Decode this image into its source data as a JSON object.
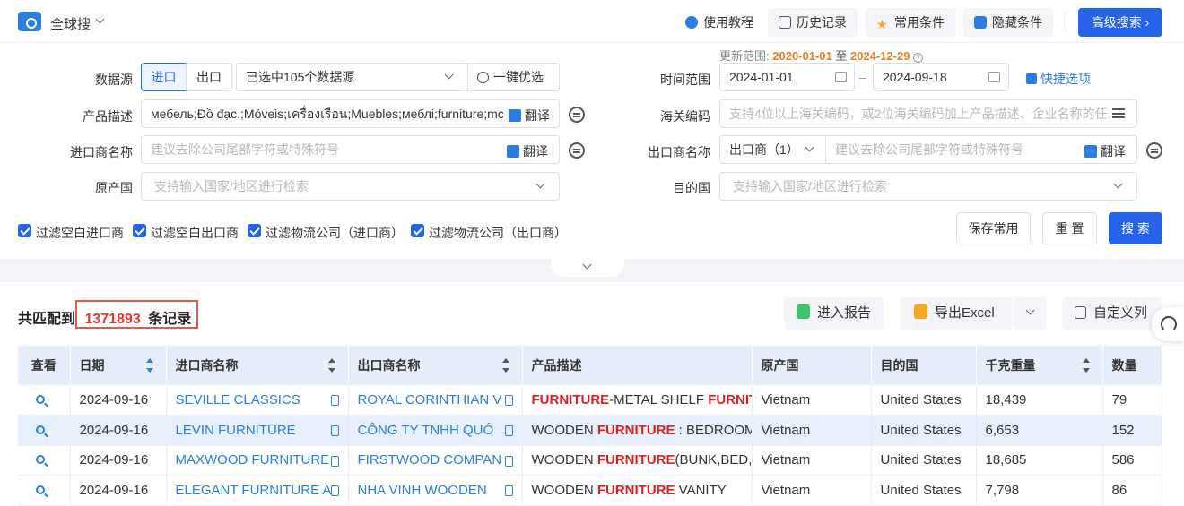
{
  "header": {
    "app_title": "全球搜",
    "buttons": [
      "使用教程",
      "历史记录",
      "常用条件",
      "隐藏条件"
    ],
    "advanced_search": "高级搜索",
    "advanced_arrow": "›"
  },
  "update_range": {
    "label": "更新范围:",
    "start": "2020-01-01",
    "sep": "至",
    "end": "2024-12-29"
  },
  "form": {
    "data_source": {
      "label": "数据源",
      "import": "进口",
      "export": "出口",
      "selected": "已选中105个数据源",
      "optimize": "一键优选"
    },
    "time_range": {
      "label": "时间范围",
      "start": "2024-01-01",
      "end": "2024-09-18",
      "dash": "–",
      "quick": "快捷选项"
    },
    "product_desc": {
      "label": "产品描述",
      "value": "мебель;Đồ đạc.;Móveis;เครื่องเรือน;Muebles;меблі;furniture;mc",
      "translate": "翻译"
    },
    "hs_code": {
      "label": "海关编码",
      "placeholder": "支持4位以上海关编码，或2位海关编码加上产品描述、企业名称的任..."
    },
    "importer": {
      "label": "进口商名称",
      "placeholder": "建议去除公司尾部字符或特殊符号",
      "translate": "翻译"
    },
    "exporter": {
      "label": "出口商名称",
      "type": "出口商（1）",
      "placeholder": "建议去除公司尾部字符或特殊符号",
      "translate": "翻译"
    },
    "origin": {
      "label": "原产国",
      "placeholder": "支持输入国家/地区进行检索"
    },
    "destination": {
      "label": "目的国",
      "placeholder": "支持输入国家/地区进行检索"
    },
    "filters": [
      "过滤空白进口商",
      "过滤空白出口商",
      "过滤物流公司（进口商）",
      "过滤物流公司（出口商）"
    ],
    "save": "保存常用",
    "reset": "重 置",
    "search": "搜 索"
  },
  "results": {
    "prefix": "共匹配到",
    "count": "1371893",
    "suffix": "条记录",
    "report": "进入报告",
    "export": "导出Excel",
    "custom": "自定义列"
  },
  "table": {
    "columns": [
      "查看",
      "日期",
      "进口商名称",
      "出口商名称",
      "产品描述",
      "原产国",
      "目的国",
      "千克重量",
      "数量"
    ],
    "rows": [
      {
        "date": "2024-09-16",
        "importer": "SEVILLE CLASSICS",
        "exporter": "ROYAL CORINTHIAN V",
        "desc_pre": "",
        "desc_hl": "FURNITURE",
        "desc_post": "-METAL SHELF ",
        "desc_hl2": "FURNIT",
        "origin": "Vietnam",
        "dest": "United States",
        "kg": "18,439",
        "qty": "79"
      },
      {
        "date": "2024-09-16",
        "importer": "LEVIN FURNITURE",
        "exporter": "CÔNG TY TNHH QUÓ",
        "desc_pre": "WOODEN ",
        "desc_hl": "FURNITURE",
        "desc_post": " : BEDROOM",
        "desc_hl2": "",
        "origin": "Vietnam",
        "dest": "United States",
        "kg": "6,653",
        "qty": "152"
      },
      {
        "date": "2024-09-16",
        "importer": "MAXWOOD FURNITURE",
        "exporter": "FIRSTWOOD COMPAN",
        "desc_pre": "WOODEN ",
        "desc_hl": "FURNITURE",
        "desc_post": "(BUNK,BED,C",
        "desc_hl2": "",
        "origin": "Vietnam",
        "dest": "United States",
        "kg": "18,685",
        "qty": "586"
      },
      {
        "date": "2024-09-16",
        "importer": "ELEGANT FURNITURE A",
        "exporter": "NHA VINH WOODEN",
        "desc_pre": "WOODEN ",
        "desc_hl": "FURNITURE",
        "desc_post": " VANITY",
        "desc_hl2": "",
        "origin": "Vietnam",
        "dest": "United States",
        "kg": "7,798",
        "qty": "86"
      }
    ]
  },
  "colors": {
    "accent": "#2563eb",
    "highlight": "#e02020",
    "row_highlight": "#e7f0fc",
    "date_accent": "#e67e22"
  }
}
